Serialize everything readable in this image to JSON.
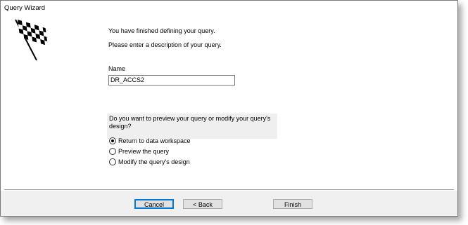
{
  "window": {
    "title": "Query Wizard"
  },
  "intro": {
    "line1": "You have finished defining your query.",
    "line2": "Please enter a description of your query."
  },
  "name_field": {
    "label": "Name",
    "value": "DR_ACCS2"
  },
  "preview": {
    "question": "Do you want to preview your query or modify your query's design?",
    "options": [
      {
        "label": "Return to data workspace",
        "checked": true
      },
      {
        "label": "Preview the query",
        "checked": false
      },
      {
        "label": "Modify the query's design",
        "checked": false
      }
    ]
  },
  "buttons": {
    "cancel": "Cancel",
    "back": "< Back",
    "finish": "Finish"
  },
  "icons": {
    "wizard": "checkered-flag-icon"
  }
}
